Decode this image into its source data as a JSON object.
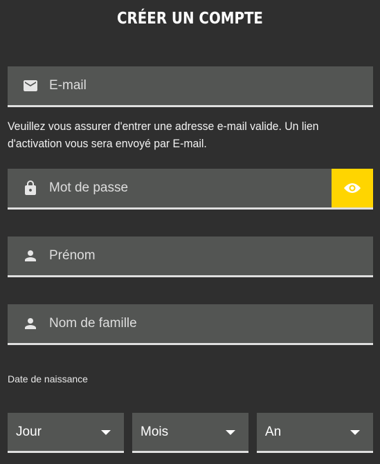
{
  "header": {
    "title": "CRÉER UN COMPTE"
  },
  "email": {
    "icon": "mail-icon",
    "placeholder": "E-mail",
    "value": "",
    "help_line1": "Veuillez vous assurer d'entrer une adresse e-mail valide. Un lien",
    "help_line2": "d'activation vous sera envoyé par E-mail."
  },
  "password": {
    "icon": "lock-icon",
    "placeholder": "Mot de passe",
    "value": "",
    "toggle_icon": "eye-icon"
  },
  "first_name": {
    "icon": "person-icon",
    "placeholder": "Prénom",
    "value": ""
  },
  "last_name": {
    "icon": "person-icon",
    "placeholder": "Nom de famille",
    "value": ""
  },
  "birthdate": {
    "label": "Date de naissance",
    "day": "Jour",
    "month": "Mois",
    "year": "An"
  },
  "colors": {
    "background": "#2f2f2f",
    "field": "#535553",
    "accent": "#ffd500",
    "underline": "#dfdfdf"
  }
}
